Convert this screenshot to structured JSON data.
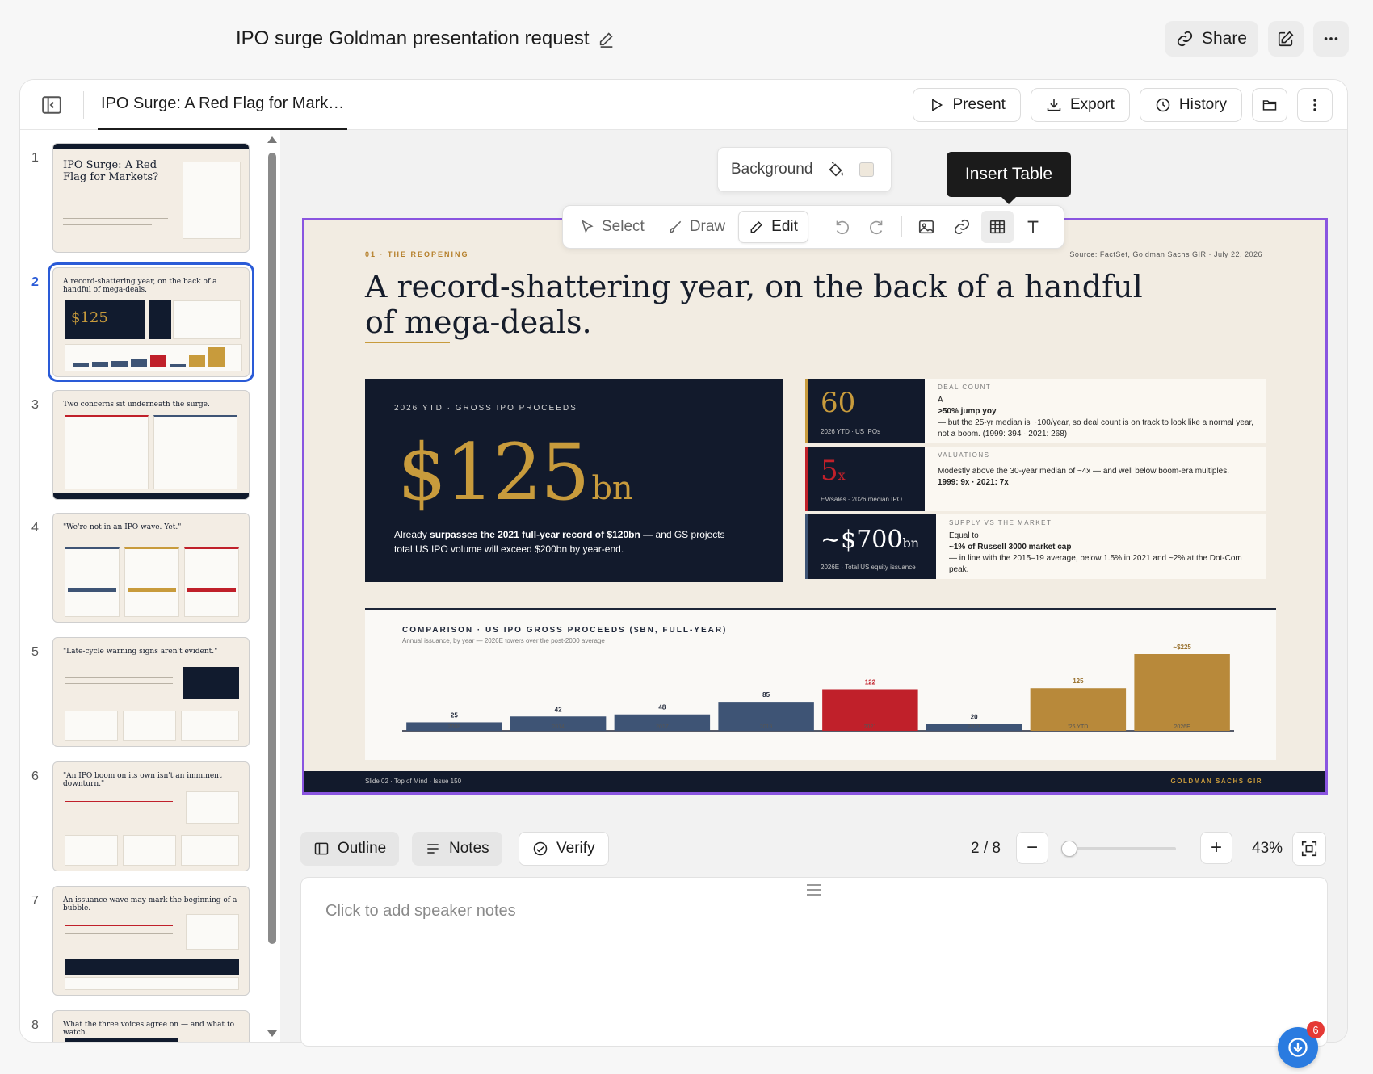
{
  "header": {
    "doc_title": "IPO surge Goldman presentation request",
    "share_label": "Share"
  },
  "panel": {
    "tab_title": "IPO Surge: A Red Flag for Mark…",
    "present_label": "Present",
    "export_label": "Export",
    "history_label": "History"
  },
  "thumbnails": [
    {
      "num": "1",
      "title": "IPO Surge: A Red Flag for Markets?"
    },
    {
      "num": "2",
      "title": "A record-shattering year, on the back of a handful of mega-deals."
    },
    {
      "num": "3",
      "title": "Two concerns sit underneath the surge."
    },
    {
      "num": "4",
      "title": "\"We're not in an IPO wave. Yet.\""
    },
    {
      "num": "5",
      "title": "\"Late-cycle warning signs aren't evident.\""
    },
    {
      "num": "6",
      "title": "\"An IPO boom on its own isn't an imminent downturn.\""
    },
    {
      "num": "7",
      "title": "An issuance wave may mark the beginning of a bubble."
    },
    {
      "num": "8",
      "title": "What the three voices agree on — and what to watch."
    }
  ],
  "background_popover": {
    "label": "Background",
    "swatch": "#efe8dc"
  },
  "tooltip": "Insert Table",
  "toolbar": {
    "select": "Select",
    "draw": "Draw",
    "edit": "Edit"
  },
  "slide": {
    "kicker": "01 · THE REOPENING",
    "source": "Source: FactSet, Goldman Sachs GIR · July 22, 2026",
    "title": "A record-shattering year, on the back of a handful of mega-deals.",
    "hero": {
      "kicker": "2026 YTD · GROSS IPO PROCEEDS",
      "number": "$125",
      "unit": "bn",
      "desc_pre": "Already ",
      "desc_bold": "surpasses the 2021 full-year record of $120bn",
      "desc_post": " — and GS projects total US IPO volume will exceed $200bn by year-end."
    },
    "stats": [
      {
        "num": "60",
        "unit": "",
        "cap": "2026 YTD · US IPOs",
        "label": "DEAL COUNT",
        "line1": "A",
        "bold": ">50% jump yoy",
        "text": "— but the 25-yr median is ~100/year, so deal count is on track to look like a normal year, not a boom. (1999: 394 · 2021: 268)"
      },
      {
        "num": "5",
        "unit": "x",
        "cap": "EV/sales · 2026 median IPO",
        "label": "VALUATIONS",
        "line1": "",
        "bold": "",
        "text": "Modestly above the 30-year median of ~4x — and well below boom-era multiples.",
        "bold2": "1999: 9x · 2021: 7x"
      },
      {
        "num": "~$700",
        "unit": "bn",
        "cap": "2026E · Total US equity issuance",
        "label": "SUPPLY VS THE MARKET",
        "line1": "Equal to",
        "bold": "~1% of Russell 3000 market cap",
        "text": "— in line with the 2015–19 average, below 1.5% in 2021 and ~2% at the Dot-Com peak."
      }
    ],
    "chart_title": "COMPARISON · US IPO GROSS PROCEEDS ($BN, FULL-YEAR)",
    "chart_sub": "Annual issuance, by year — 2026E towers over the post-2000 average",
    "footer_left": "Slide 02 · Top of Mind · Issue 150",
    "footer_right": "GOLDMAN SACHS GIR"
  },
  "chart_data": {
    "type": "bar",
    "categories": [
      "2008",
      "2014",
      "2017",
      "2019",
      "2021",
      "2023",
      "'26 YTD",
      "2026E"
    ],
    "values": [
      25,
      42,
      48,
      85,
      122,
      20,
      125,
      225
    ],
    "value_labels": [
      "25",
      "42",
      "48",
      "85",
      "122",
      "20",
      "125",
      "~$225"
    ],
    "colors": [
      "#3e5475",
      "#3e5475",
      "#3e5475",
      "#3e5475",
      "#c0202a",
      "#3e5475",
      "#b8893a",
      "#b8893a"
    ],
    "title": "COMPARISON · US IPO GROSS PROCEEDS ($BN, FULL-YEAR)",
    "ylim": [
      0,
      225
    ]
  },
  "bottom": {
    "outline_label": "Outline",
    "notes_label": "Notes",
    "verify_label": "Verify",
    "page_indicator": "2 / 8",
    "zoom_minus": "−",
    "zoom_plus": "+",
    "zoom_pct": "43%",
    "zoom_level": 0.0
  },
  "notes": {
    "placeholder": "Click to add speaker notes"
  },
  "help_badge": "6"
}
